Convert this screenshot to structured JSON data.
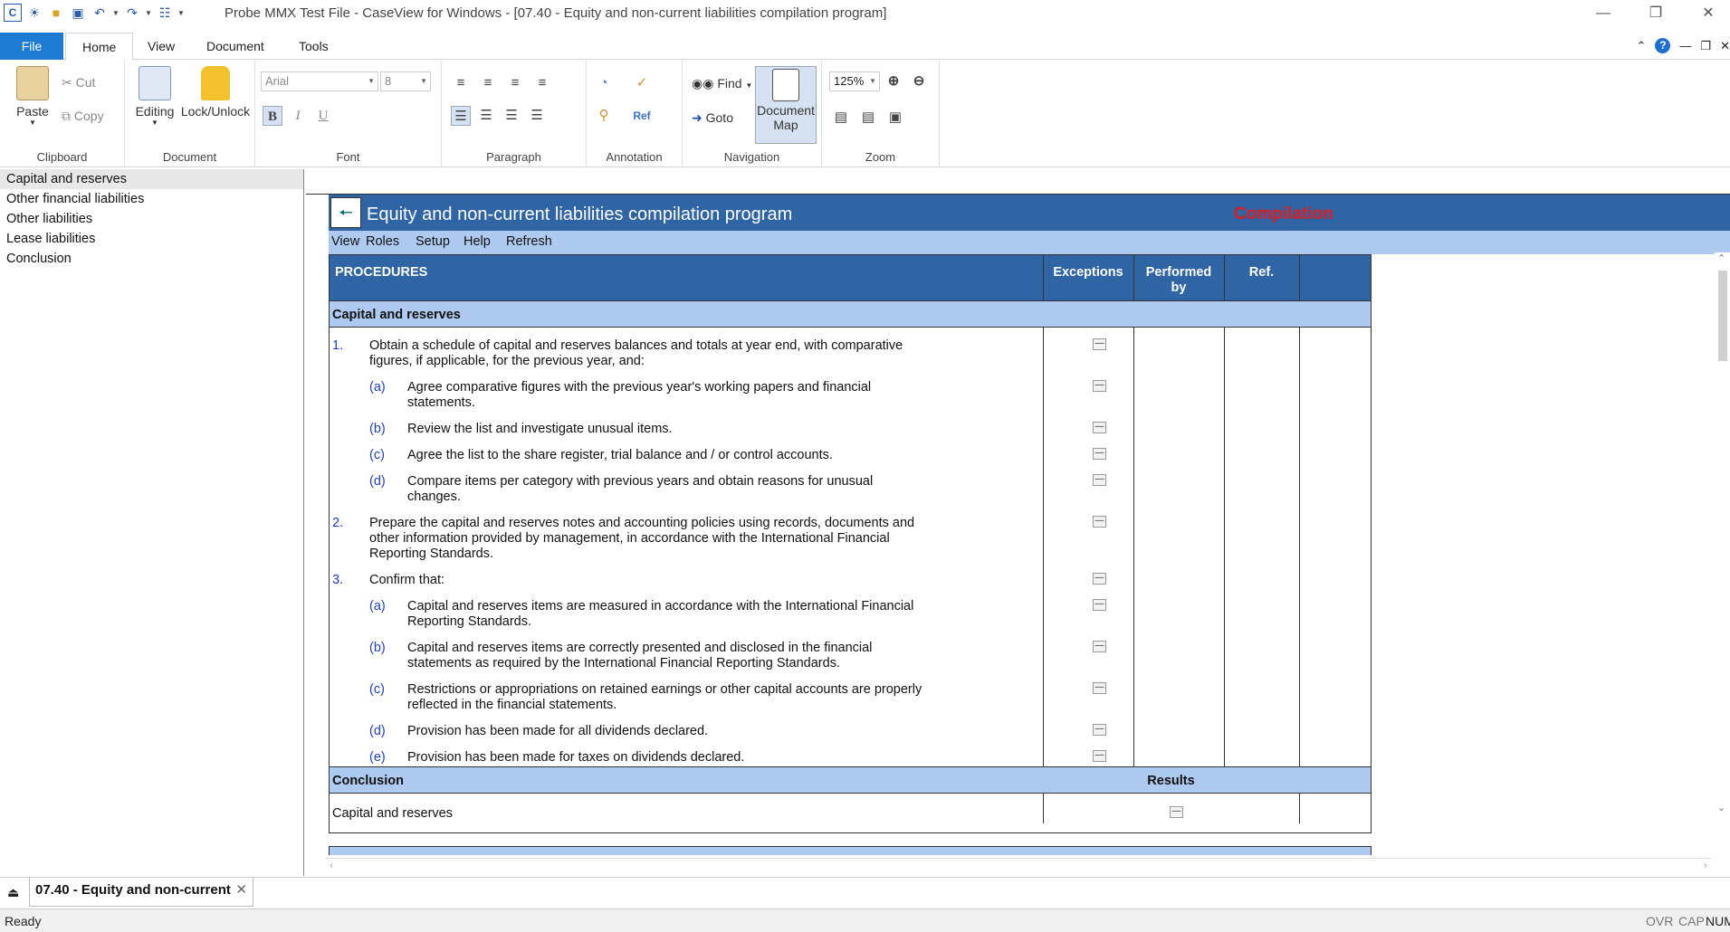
{
  "window": {
    "title": "Probe MMX Test File - CaseView for Windows - [07.40 - Equity and non-current liabilities compilation program]"
  },
  "ribbon": {
    "tabs": [
      "File",
      "Home",
      "View",
      "Document",
      "Tools"
    ],
    "clipboard": {
      "paste": "Paste",
      "cut": "Cut",
      "copy": "Copy",
      "label": "Clipboard"
    },
    "document": {
      "editing": "Editing",
      "lock": "Lock/Unlock",
      "label": "Document"
    },
    "font": {
      "name": "Arial",
      "size": "8",
      "label": "Font"
    },
    "paragraph": {
      "label": "Paragraph"
    },
    "annotation": {
      "label": "Annotation"
    },
    "navigation": {
      "find": "Find",
      "goto": "Goto",
      "docmap_line1": "Document",
      "docmap_line2": "Map",
      "label": "Navigation"
    },
    "zoom": {
      "value": "125%",
      "label": "Zoom"
    }
  },
  "nav": {
    "items": [
      "Capital and reserves",
      "Other financial liabilities",
      "Other liabilities",
      "Lease liabilities",
      "Conclusion"
    ]
  },
  "doc": {
    "title": "Equity and non-current liabilities compilation program",
    "status": "Compilation",
    "menu": [
      "View",
      "Roles",
      "Setup",
      "Help",
      "Refresh"
    ],
    "headers": {
      "procedures": "PROCEDURES",
      "exceptions": "Exceptions",
      "performed_line1": "Performed",
      "performed_line2": "by",
      "ref": "Ref."
    },
    "section": "Capital and reserves",
    "rows": [
      {
        "num": "1.",
        "text1": "Obtain a schedule of capital and reserves balances and totals at year end, with comparative",
        "text2": "figures, if applicable, for the previous year, and:",
        "text3": ""
      },
      {
        "num": "(a)",
        "text1": "Agree comparative figures with the previous year's working papers and financial",
        "text2": "statements.",
        "text3": ""
      },
      {
        "num": "(b)",
        "text1": "Review the list and investigate unusual items.",
        "text2": "",
        "text3": ""
      },
      {
        "num": "(c)",
        "text1": "Agree the list to the share register, trial balance and / or control accounts.",
        "text2": "",
        "text3": ""
      },
      {
        "num": "(d)",
        "text1": "Compare items per category with previous years and obtain reasons for unusual",
        "text2": "changes.",
        "text3": ""
      },
      {
        "num": "2.",
        "text1": "Prepare the capital and reserves notes and accounting policies using records, documents and",
        "text2": "other information provided by management, in accordance with the International Financial",
        "text3": "Reporting Standards."
      },
      {
        "num": "3.",
        "text1": "Confirm that:",
        "text2": "",
        "text3": ""
      },
      {
        "num": "(a)",
        "text1": "Capital and reserves items are measured in accordance with the International Financial",
        "text2": "Reporting Standards.",
        "text3": ""
      },
      {
        "num": "(b)",
        "text1": "Capital and reserves items are correctly presented and disclosed in the financial",
        "text2": "statements as required by the International Financial Reporting Standards.",
        "text3": ""
      },
      {
        "num": "(c)",
        "text1": "Restrictions or appropriations on retained earnings or other capital accounts are properly",
        "text2": "reflected in the financial statements.",
        "text3": ""
      },
      {
        "num": "(d)",
        "text1": "Provision has been made for all dividends declared.",
        "text2": "",
        "text3": ""
      },
      {
        "num": "(e)",
        "text1": "Provision has been made for taxes on dividends declared.",
        "text2": "",
        "text3": ""
      }
    ],
    "conclusion": {
      "label": "Conclusion",
      "results": "Results",
      "row": "Capital and reserves"
    }
  },
  "tabbar": {
    "doc_tab": "07.40 - Equity and non-current"
  },
  "status": {
    "ready": "Ready",
    "ovr": "OVR",
    "cap": "CAP",
    "num": "NUM"
  },
  "colors": {
    "header_blue": "#2f64a5",
    "light_blue": "#aecaf0",
    "accent_red": "#e21b1b",
    "file_tab": "#1e7bd4"
  }
}
